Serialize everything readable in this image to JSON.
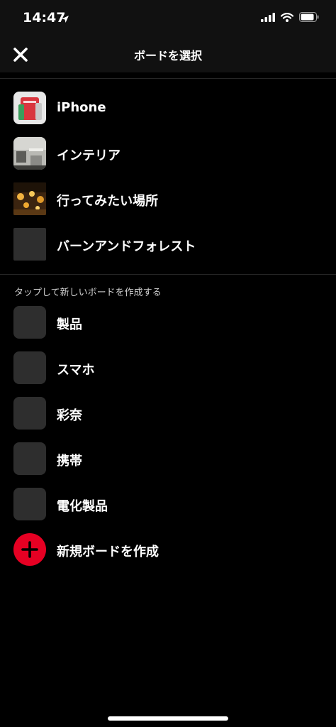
{
  "status": {
    "time": "14:47"
  },
  "header": {
    "title": "ボードを選択"
  },
  "boards": [
    {
      "label": "iPhone"
    },
    {
      "label": "インテリア"
    },
    {
      "label": "行ってみたい場所"
    },
    {
      "label": "バーンアンドフォレスト"
    }
  ],
  "suggestions": {
    "heading": "タップして新しいボードを作成する",
    "items": [
      {
        "label": "製品"
      },
      {
        "label": "スマホ"
      },
      {
        "label": "彩奈"
      },
      {
        "label": "携帯"
      },
      {
        "label": "電化製品"
      }
    ]
  },
  "create": {
    "label": "新規ボードを作成"
  },
  "colors": {
    "accent": "#e60023",
    "background": "#000000",
    "header": "#111111"
  }
}
